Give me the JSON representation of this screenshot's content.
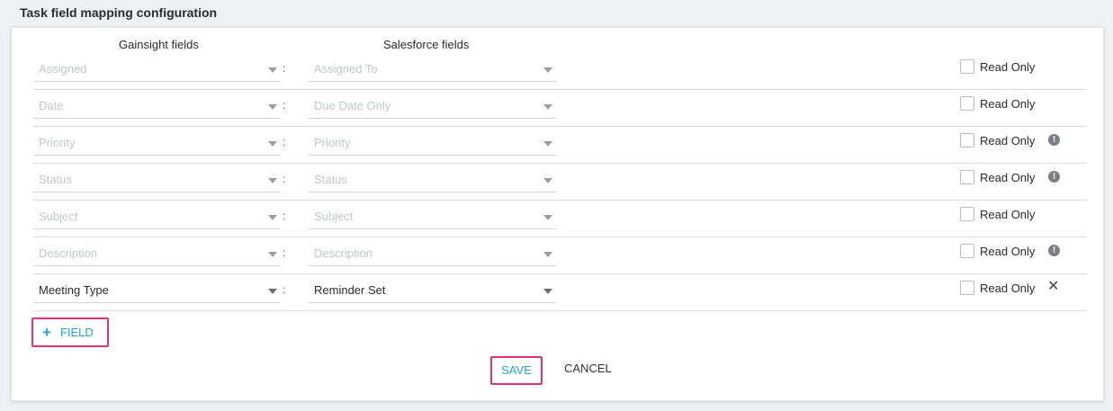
{
  "page_title": "Task field mapping configuration",
  "columns": {
    "gainsight": "Gainsight fields",
    "salesforce": "Salesforce fields"
  },
  "separator": ":",
  "rows": [
    {
      "gainsight": "Assigned",
      "salesforce": "Assigned To",
      "read_only_label": "Read Only",
      "read_only_checked": false,
      "gs_set": false,
      "sf_set": false,
      "trailing_icon": null
    },
    {
      "gainsight": "Date",
      "salesforce": "Due Date Only",
      "read_only_label": "Read Only",
      "read_only_checked": false,
      "gs_set": false,
      "sf_set": false,
      "trailing_icon": null
    },
    {
      "gainsight": "Priority",
      "salesforce": "Priority",
      "read_only_label": "Read Only",
      "read_only_checked": false,
      "gs_set": false,
      "sf_set": false,
      "trailing_icon": "exclamation-icon"
    },
    {
      "gainsight": "Status",
      "salesforce": "Status",
      "read_only_label": "Read Only",
      "read_only_checked": false,
      "gs_set": false,
      "sf_set": false,
      "trailing_icon": "exclamation-icon"
    },
    {
      "gainsight": "Subject",
      "salesforce": "Subject",
      "read_only_label": "Read Only",
      "read_only_checked": false,
      "gs_set": false,
      "sf_set": false,
      "trailing_icon": null
    },
    {
      "gainsight": "Description",
      "salesforce": "Description",
      "read_only_label": "Read Only",
      "read_only_checked": false,
      "gs_set": false,
      "sf_set": false,
      "trailing_icon": "exclamation-icon"
    },
    {
      "gainsight": "Meeting Type",
      "salesforce": "Reminder Set",
      "read_only_label": "Read Only",
      "read_only_checked": false,
      "gs_set": true,
      "sf_set": true,
      "trailing_icon": "close-icon"
    }
  ],
  "add_field": {
    "plus": "+",
    "label": "FIELD"
  },
  "actions": {
    "save": "SAVE",
    "cancel": "CANCEL"
  },
  "colors": {
    "accent": "#1ea7d4",
    "highlight": "#e8326b"
  }
}
